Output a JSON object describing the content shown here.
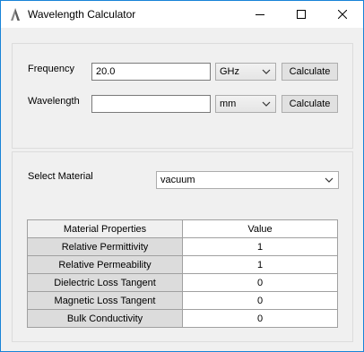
{
  "window": {
    "title": "Wavelength Calculator"
  },
  "frequency": {
    "label": "Frequency",
    "value": "20.0",
    "unit": "GHz",
    "button": "Calculate"
  },
  "wavelength": {
    "label": "Wavelength",
    "value": "",
    "unit": "mm",
    "button": "Calculate"
  },
  "material": {
    "label": "Select Material",
    "selected": "vacuum"
  },
  "table": {
    "headers": [
      "Material Properties",
      "Value"
    ],
    "rows": [
      {
        "property": "Relative Permittivity",
        "value": "1"
      },
      {
        "property": "Relative Permeability",
        "value": "1"
      },
      {
        "property": "Dielectric Loss Tangent",
        "value": "0"
      },
      {
        "property": "Magnetic Loss Tangent",
        "value": "0"
      },
      {
        "property": "Bulk Conductivity",
        "value": "0"
      }
    ]
  },
  "colors": {
    "window_border": "#1883d7",
    "background": "#f0f0f0",
    "row_header": "#dcdcdc"
  },
  "icons": [
    "app-icon",
    "minimize-icon",
    "maximize-icon",
    "close-icon",
    "chevron-down-icon"
  ]
}
